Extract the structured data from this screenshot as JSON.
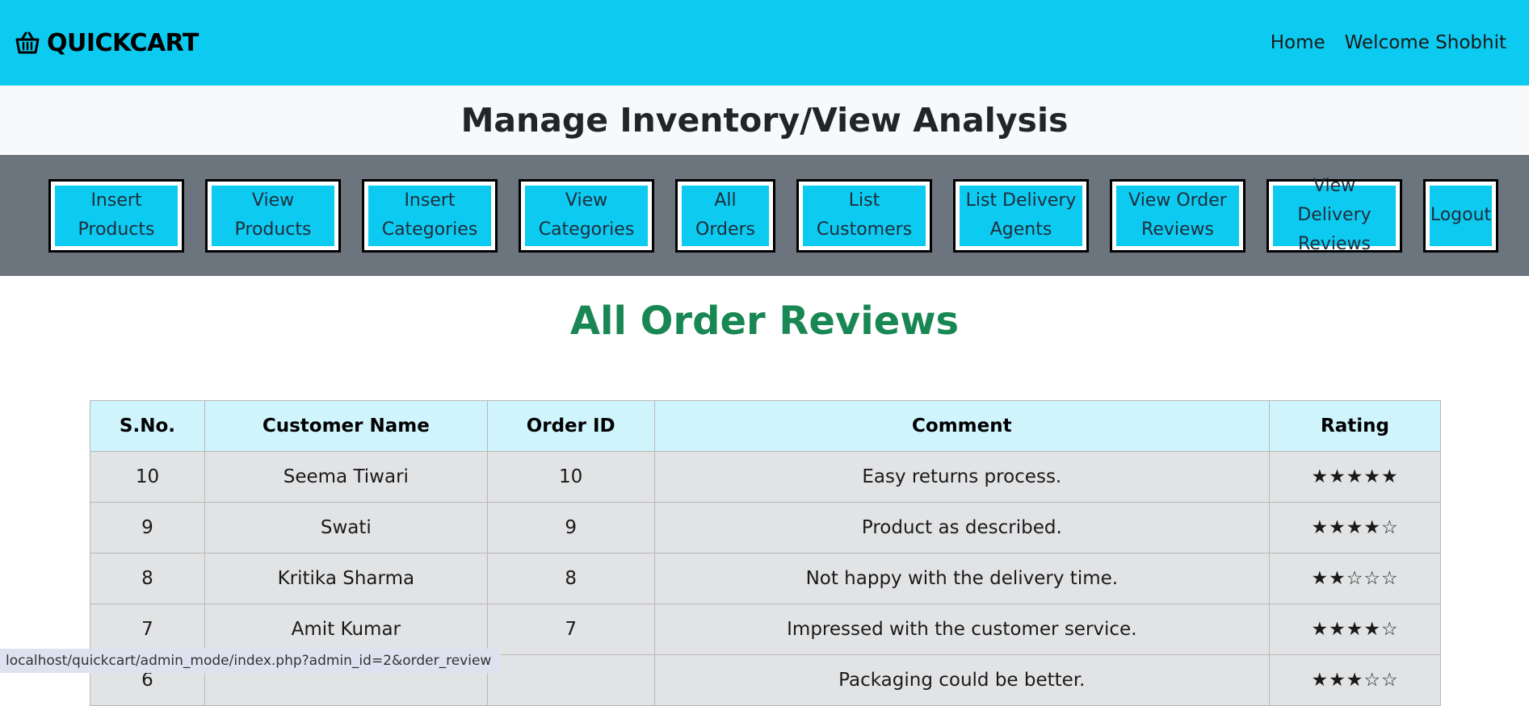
{
  "brand": {
    "name": "QUICKCART"
  },
  "nav": {
    "home": "Home",
    "welcome": "Welcome Shobhit"
  },
  "page": {
    "title": "Manage Inventory/View Analysis"
  },
  "admin_menu": [
    {
      "label": "Insert Products"
    },
    {
      "label": "View Products"
    },
    {
      "label": "Insert Categories"
    },
    {
      "label": "View Categories"
    },
    {
      "label": "All Orders"
    },
    {
      "label": "List Customers"
    },
    {
      "label": "List Delivery Agents"
    },
    {
      "label": "View Order Reviews"
    },
    {
      "label": "View Delivery Reviews"
    },
    {
      "label": "Logout"
    }
  ],
  "section": {
    "title": "All Order Reviews"
  },
  "table": {
    "headers": [
      "S.No.",
      "Customer Name",
      "Order ID",
      "Comment",
      "Rating"
    ],
    "rows": [
      {
        "sno": "10",
        "name": "Seema Tiwari",
        "order_id": "10",
        "comment": "Easy returns process.",
        "rating": 5
      },
      {
        "sno": "9",
        "name": "Swati",
        "order_id": "9",
        "comment": "Product as described.",
        "rating": 4
      },
      {
        "sno": "8",
        "name": "Kritika Sharma",
        "order_id": "8",
        "comment": "Not happy with the delivery time.",
        "rating": 2
      },
      {
        "sno": "7",
        "name": "Amit Kumar",
        "order_id": "7",
        "comment": "Impressed with the customer service.",
        "rating": 4
      },
      {
        "sno": "6",
        "name": "",
        "order_id": "",
        "comment": "Packaging could be better.",
        "rating": 3
      }
    ]
  },
  "status_bar": {
    "url": "localhost/quickcart/admin_mode/index.php?admin_id=2&order_review"
  },
  "colors": {
    "navbar": "#0dcaf0",
    "admin_bar": "#6c757d",
    "section_title": "#198754",
    "table_header": "#cff4fc",
    "table_cell": "#e2e3e5"
  },
  "icons": {
    "brand": "basket-icon"
  }
}
